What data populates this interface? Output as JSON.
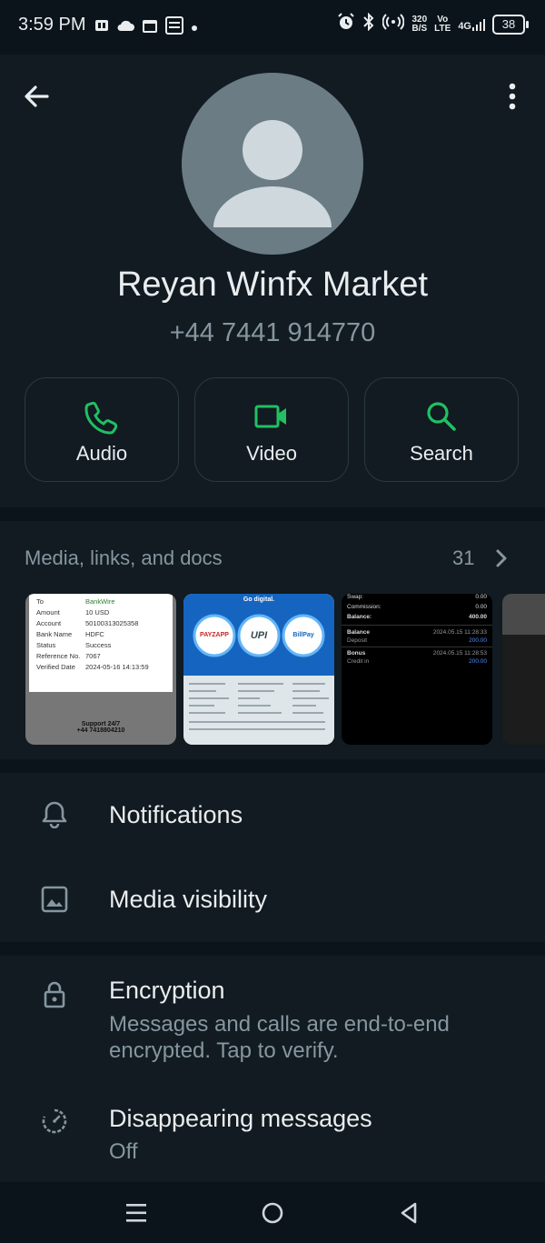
{
  "status_bar": {
    "time": "3:59 PM",
    "net_speed_value": "320",
    "net_speed_unit": "B/S",
    "volte_top": "Vo",
    "volte_bottom": "LTE",
    "network": "4G",
    "battery": "38"
  },
  "contact": {
    "name": "Reyan Winfx Market",
    "phone": "+44 7441 914770"
  },
  "actions": [
    {
      "label": "Audio",
      "icon": "phone-icon"
    },
    {
      "label": "Video",
      "icon": "video-icon"
    },
    {
      "label": "Search",
      "icon": "search-icon"
    }
  ],
  "media": {
    "title": "Media, links, and docs",
    "count": "31",
    "thumb1": {
      "rows": [
        {
          "k": "To",
          "v": "BankWire"
        },
        {
          "k": "Amount",
          "v": "10 USD"
        },
        {
          "k": "Account",
          "v": "50100313025358"
        },
        {
          "k": "Bank Name",
          "v": "HDFC"
        },
        {
          "k": "Status",
          "v": "Success"
        },
        {
          "k": "Reference No.",
          "v": "7067"
        },
        {
          "k": "Verified Date",
          "v": "2024-05-16 14:13:59"
        }
      ],
      "footer_line1": "Support 24/7",
      "footer_line2": "+44 7418804210"
    },
    "thumb2": {
      "heading": "Go digital.",
      "badge1": "PAYZAPP",
      "badge2": "UPI",
      "badge3": "BillPay"
    },
    "thumb3": {
      "swap_label": "Swap:",
      "swap_value": "0.00",
      "commission_label": "Commission:",
      "commission_value": "0.00",
      "balance_label": "Balance:",
      "balance_value": "400.00",
      "entry1_title": "Balance",
      "entry1_sub": "Deposit",
      "entry1_date": "2024.05.15 11:28:33",
      "entry1_amount": "200.00",
      "entry2_title": "Bonus",
      "entry2_sub": "Credit in",
      "entry2_date": "2024.05.15 11:28:53",
      "entry2_amount": "200.00"
    }
  },
  "settings": {
    "notifications": "Notifications",
    "media_visibility": "Media visibility",
    "encryption_title": "Encryption",
    "encryption_sub": "Messages and calls are end-to-end encrypted. Tap to verify.",
    "disappearing_title": "Disappearing messages",
    "disappearing_sub": "Off"
  },
  "colors": {
    "background": "#0b141a",
    "panel": "#111b21",
    "accent_green": "#21c063",
    "secondary_text": "#8696a0"
  }
}
